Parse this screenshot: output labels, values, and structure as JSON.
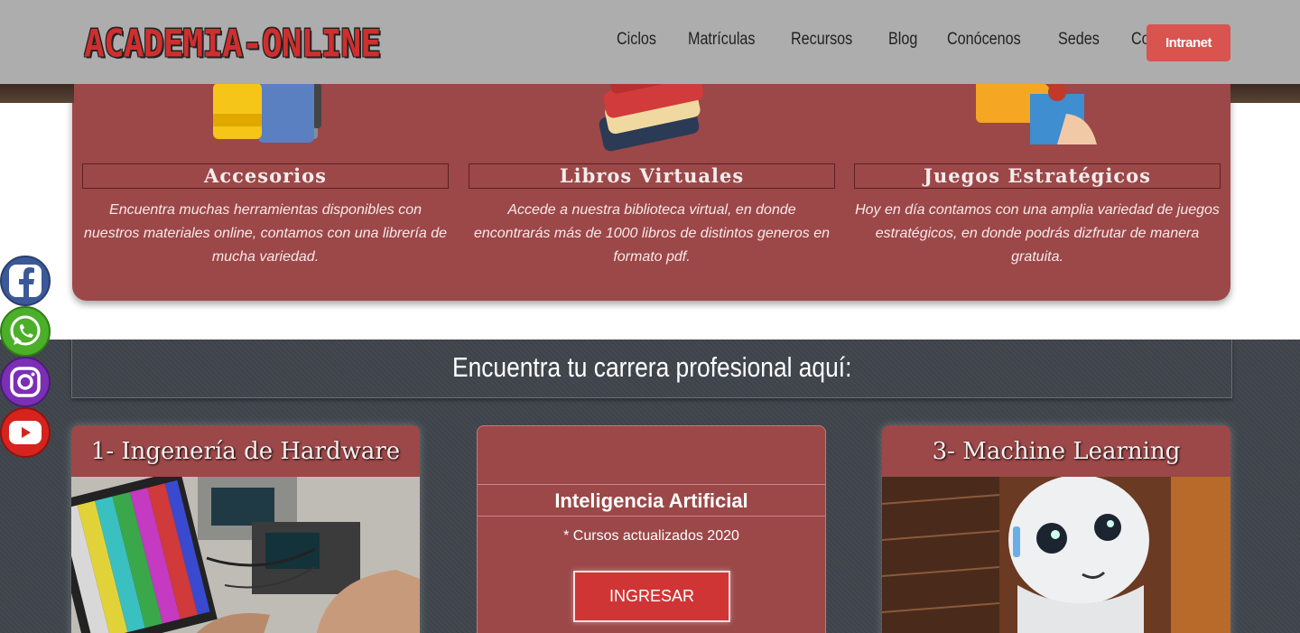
{
  "header": {
    "brand": "ACADEMIA-ONLINE",
    "nav": [
      "Ciclos",
      "Matrículas",
      "Recursos",
      "Blog",
      "Conócenos",
      "Sedes",
      "Contacto"
    ],
    "intranet_label": "Intranet"
  },
  "features": [
    {
      "title": "Accesorios",
      "description": "Encuentra muchas herramientas disponibles con nuestros materiales online, contamos con una librería de mucha variedad.",
      "icon": "backpack-icon"
    },
    {
      "title": "Libros Virtuales",
      "description": "Accede a nuestra biblioteca virtual, en donde encontrarás más de 1000 libros de distintos generos en formato pdf.",
      "icon": "books-icon"
    },
    {
      "title": "Juegos Estratégicos",
      "description": "Hoy en día contamos con una amplia variedad de juegos estratégicos, en donde podrás dizfrutar de manera gratuita.",
      "icon": "puzzle-icon"
    }
  ],
  "careers": {
    "heading": "Encuentra tu carrera profesional aquí:",
    "cards": [
      {
        "title": "1- Ingenería de Hardware",
        "image": "hardware-lab-photo"
      },
      {
        "title": "Inteligencia Artificial",
        "subtitle": "* Cursos actualizados 2020",
        "button": "INGRESAR"
      },
      {
        "title": "3- Machine Learning",
        "image": "robot-photo"
      }
    ]
  },
  "social": [
    "facebook-icon",
    "whatsapp-icon",
    "instagram-icon",
    "youtube-icon"
  ],
  "colors": {
    "accent": "#9c4748",
    "header_bg": "#adadad",
    "button_red": "#d9534f",
    "dark_bg": "#3e434a"
  }
}
